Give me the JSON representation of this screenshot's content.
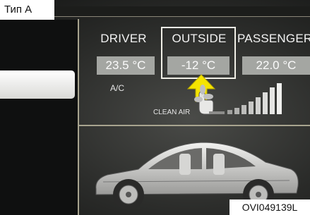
{
  "type_label": "Тип А",
  "columns": [
    {
      "title": "DRIVER",
      "temp": "23.5 °C"
    },
    {
      "title": "OUTSIDE",
      "temp": "-12 °C"
    },
    {
      "title": "PASSENGER",
      "temp": "22.0 °C"
    }
  ],
  "ac_label": "A/C",
  "clean_air_label": "CLEAN AIR",
  "image_code": "OVI049139L",
  "colors": {
    "arrow": "#f5e400",
    "frame": "#f0efe6",
    "temp_box": "#a4a6a2",
    "divider": "#a8a48f"
  },
  "icons": [
    "hand-pointer-icon",
    "fan-icon",
    "signal-bars-icon",
    "car-icon"
  ]
}
